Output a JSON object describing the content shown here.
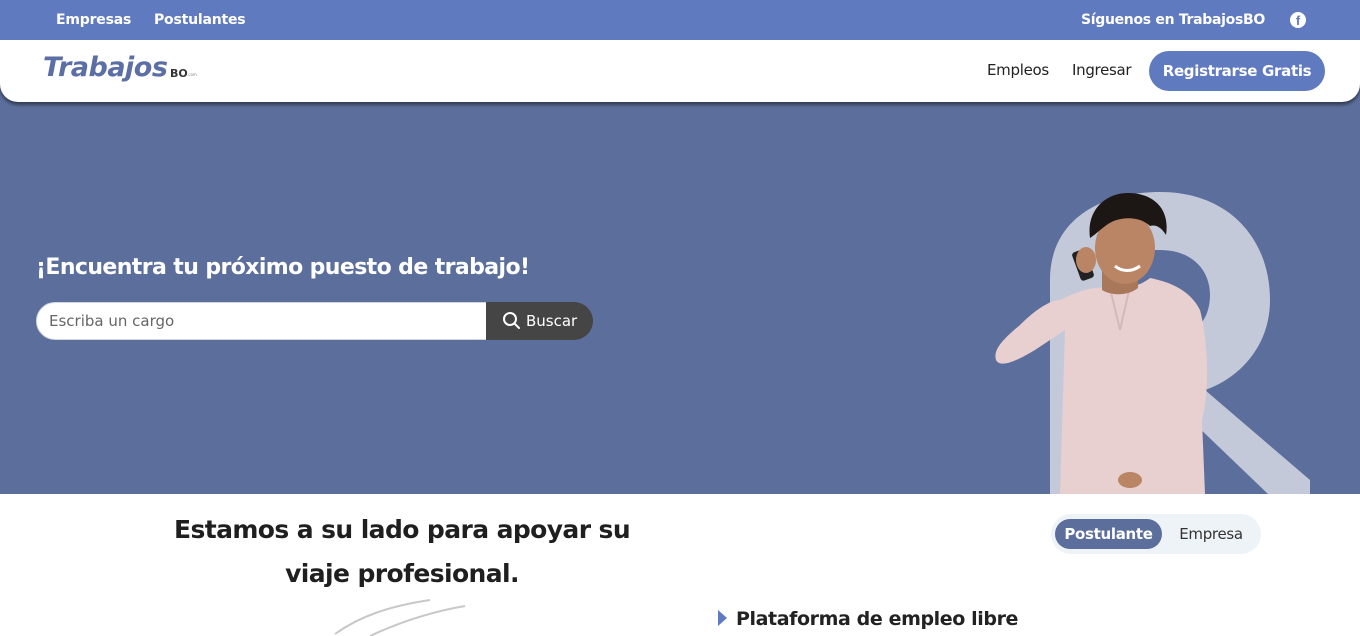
{
  "topbar": {
    "links": [
      "Empresas",
      "Postulantes"
    ],
    "follow_text": "Síguenos en TrabajosBO",
    "social_icon": "facebook-icon"
  },
  "navbar": {
    "logo_text": "Trabajos",
    "logo_suffix": "BO",
    "logo_domain": ".com",
    "links": [
      "Empleos",
      "Ingresar"
    ],
    "register_label": "Registrarse Gratis"
  },
  "hero": {
    "title": "¡Encuentra tu próximo puesto de trabajo!",
    "search_placeholder": "Escriba un cargo",
    "search_value": "",
    "search_button": "Buscar",
    "search_icon": "search-icon"
  },
  "section": {
    "title": "Estamos a su lado para apoyar su viaje profesional.",
    "toggle": {
      "options": [
        "Postulante",
        "Empresa"
      ],
      "selected": "Postulante"
    },
    "feature_item": "Plataforma de empleo libre"
  },
  "colors": {
    "accent": "#5f7abf",
    "hero_bg": "#5c6f9c",
    "search_button": "#454545"
  }
}
